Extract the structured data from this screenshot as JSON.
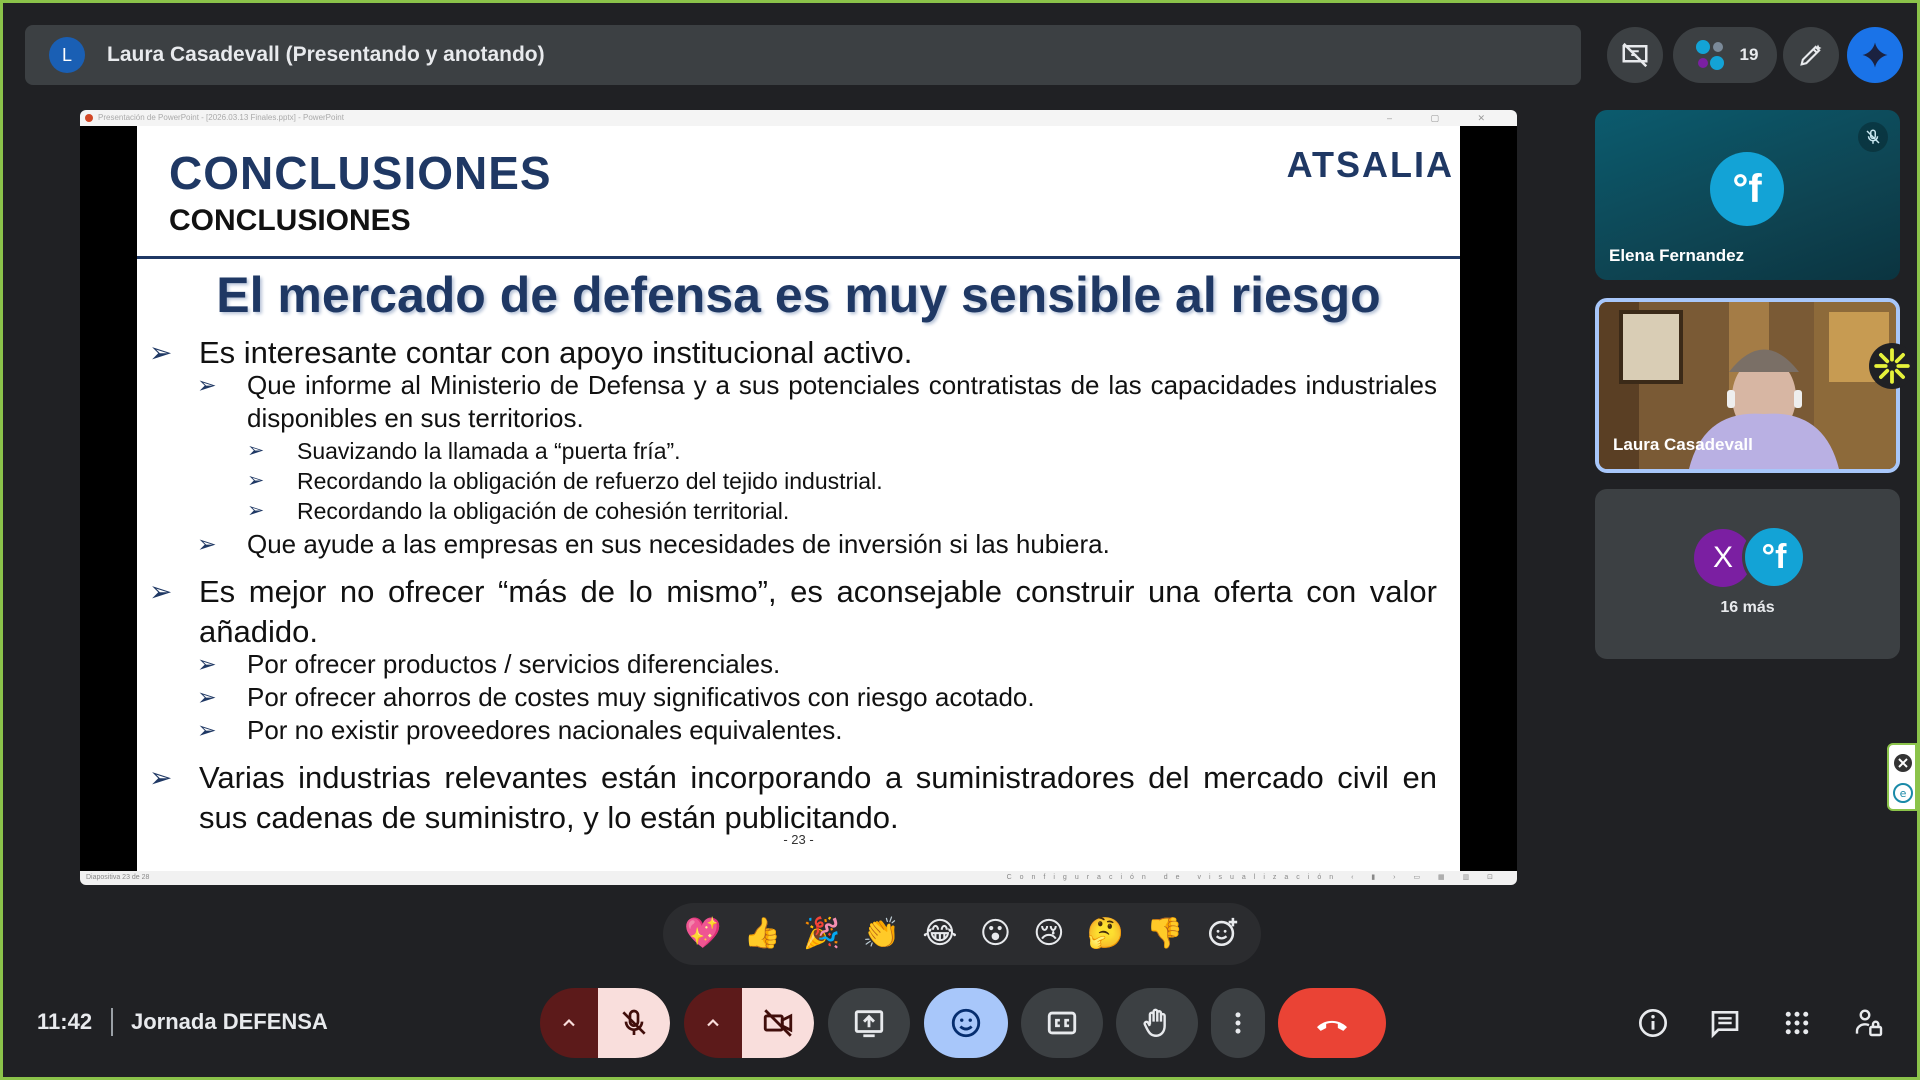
{
  "presenter": {
    "avatar_letter": "L",
    "name": "Laura Casadevall (Presentando y anotando)"
  },
  "top_controls": {
    "participants_count": "19"
  },
  "slide": {
    "heading_main": "CONCLUSIONES",
    "heading_sub": "CONCLUSIONES",
    "logo": "ATSALIA",
    "title": "El mercado de defensa es muy sensible al riesgo",
    "bullets": [
      "Es interesante contar con apoyo institucional activo.",
      "Que informe al Ministerio de Defensa y a sus potenciales contratistas de las capacidades industriales disponibles en sus territorios.",
      "Suavizando la llamada a “puerta fría”.",
      "Recordando la obligación de refuerzo del tejido industrial.",
      "Recordando la obligación de cohesión territorial.",
      "Que ayude a las empresas en sus necesidades de inversión si las hubiera.",
      "Es mejor no ofrecer “más de lo mismo”, es aconsejable construir una oferta con valor añadido.",
      "Por ofrecer productos / servicios diferenciales.",
      "Por ofrecer ahorros de costes muy significativos con riesgo acotado.",
      "Por no existir proveedores nacionales equivalentes.",
      "Varias industrias relevantes están incorporando a suministradores del mercado civil en sus cadenas de suministro, y lo están publicitando."
    ],
    "page_number": "- 23 -",
    "app_titlebar": "Presentación de PowerPoint - [2026.03.13 Finales.pptx] - PowerPoint",
    "status_left": "Diapositiva 23 de 28",
    "status_right": "Configuración de visualización"
  },
  "participants": {
    "elena": {
      "name": "Elena Fernandez",
      "avatar": "°f"
    },
    "laura": {
      "name": "Laura Casadevall"
    },
    "more": {
      "avatar_x": "X",
      "avatar_f": "°f",
      "label": "16 más"
    }
  },
  "reactions": [
    "💖",
    "👍",
    "🎉",
    "👏",
    "😂",
    "😮",
    "😢",
    "🤔",
    "👎"
  ],
  "bottom": {
    "time": "11:42",
    "meeting_name": "Jornada DEFENSA"
  },
  "colors": {
    "end_call": "#ea4335",
    "reactions_active": "#a8c7fa",
    "mic_off_bg": "#f9dedc",
    "slide_blue": "#1f3864"
  }
}
